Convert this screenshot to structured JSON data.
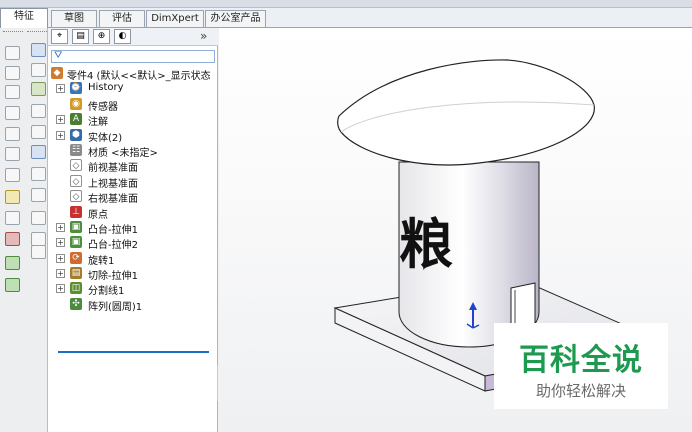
{
  "toolbar_tabs": {
    "feature": "特征",
    "sketch": "草图",
    "evaluate": "评估",
    "dimxpert": "DimXpert",
    "office": "办公室产品"
  },
  "feature_tree": {
    "root": "零件4 (默认<<默认>_显示状态",
    "items": [
      {
        "label": "History",
        "icon": "history-icon"
      },
      {
        "label": "传感器",
        "icon": "sensor-icon"
      },
      {
        "label": "注解",
        "icon": "annotation-icon"
      },
      {
        "label": "实体(2)",
        "icon": "solid-bodies-icon"
      },
      {
        "label": "材质 <未指定>",
        "icon": "material-icon"
      },
      {
        "label": "前视基准面",
        "icon": "plane-icon"
      },
      {
        "label": "上视基准面",
        "icon": "plane-icon"
      },
      {
        "label": "右视基准面",
        "icon": "plane-icon"
      },
      {
        "label": "原点",
        "icon": "origin-icon"
      },
      {
        "label": "凸台-拉伸1",
        "icon": "boss-extrude-icon"
      },
      {
        "label": "凸台-拉伸2",
        "icon": "boss-extrude-icon"
      },
      {
        "label": "旋转1",
        "icon": "revolve-icon"
      },
      {
        "label": "切除-拉伸1",
        "icon": "cut-extrude-icon"
      },
      {
        "label": "分割线1",
        "icon": "split-line-icon"
      },
      {
        "label": "阵列(圆周)1",
        "icon": "circular-pattern-icon"
      }
    ]
  },
  "model": {
    "body_text": "粮"
  },
  "watermark": {
    "title": "百科全说",
    "subtitle": "助你轻松解决"
  }
}
